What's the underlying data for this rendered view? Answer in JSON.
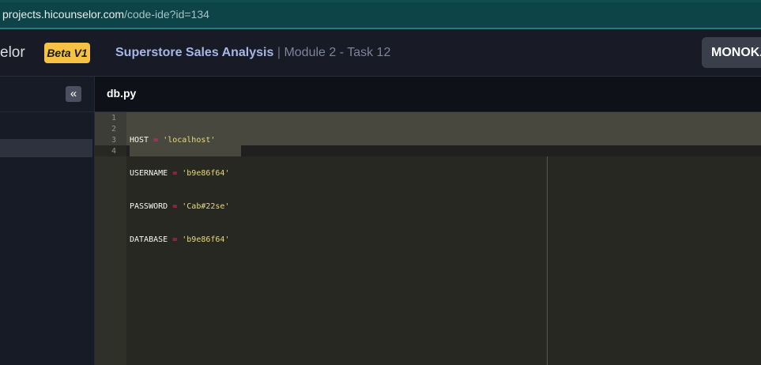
{
  "browser": {
    "url_host": "projects.hicounselor.com",
    "url_path": "/code-ide?id=134"
  },
  "header": {
    "brand_partial": "elor",
    "badge": "Beta V1",
    "project_title": "Superstore Sales Analysis",
    "separator": "|",
    "task": "Module 2 - Task 12",
    "theme_button": "MONOKAI"
  },
  "sidebar": {
    "collapse_icon": "«"
  },
  "editor": {
    "tab": "db.py",
    "line_numbers": [
      "1",
      "2",
      "3",
      "4"
    ],
    "lines": [
      {
        "name": "HOST",
        "op": "=",
        "value": "'localhost'"
      },
      {
        "name": "USERNAME",
        "op": "=",
        "value": "'b9e86f64'"
      },
      {
        "name": "PASSWORD",
        "op": "=",
        "value": "'Cab#22se'"
      },
      {
        "name": "DATABASE",
        "op": "=",
        "value": "'b9e86f64'"
      }
    ],
    "theme_colors": {
      "background": "#272822",
      "keyword": "#f92672",
      "string": "#e6db74",
      "text": "#f8f8f2"
    }
  },
  "colors": {
    "url_bar": "#0d4448",
    "header_bg": "#181b26",
    "badge_bg": "#f6c244",
    "title_accent": "#a6b6e6"
  }
}
